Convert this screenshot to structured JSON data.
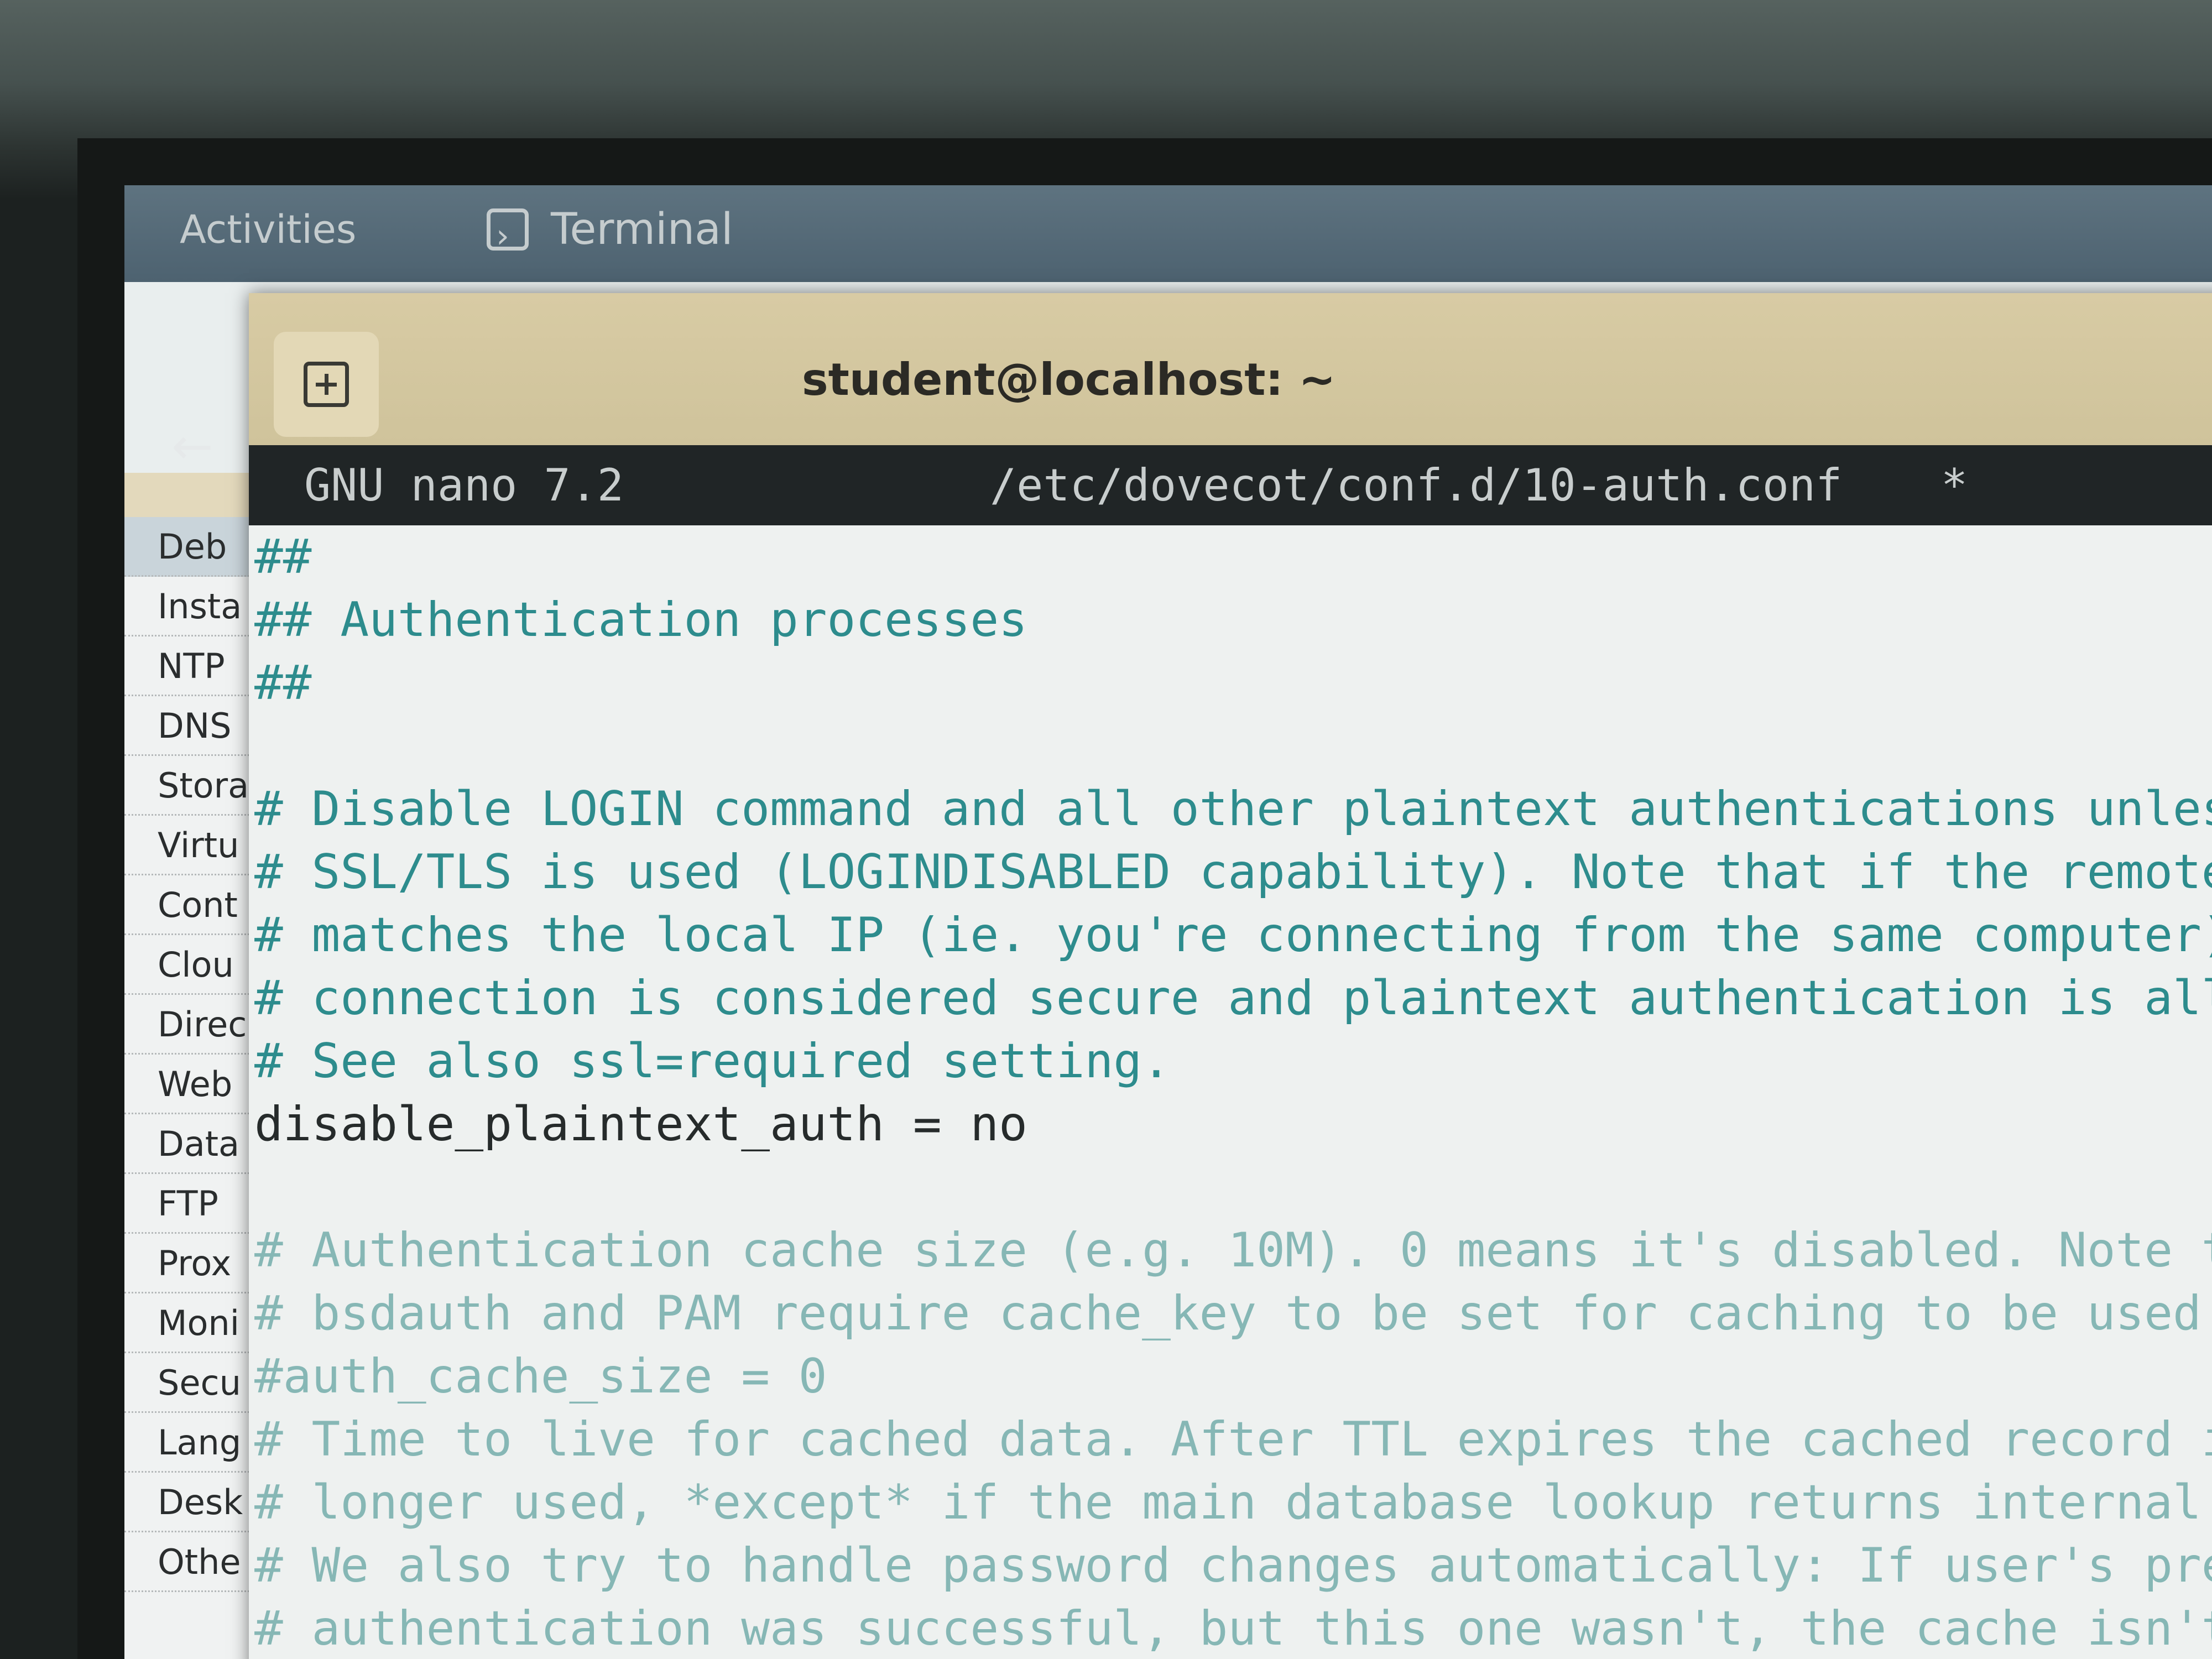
{
  "topbar": {
    "activities": "Activities",
    "app_name": "Terminal"
  },
  "sidebar": {
    "items": [
      {
        "label": "Deb",
        "active": true
      },
      {
        "label": "Insta"
      },
      {
        "label": "NTP"
      },
      {
        "label": "DNS"
      },
      {
        "label": "Stora"
      },
      {
        "label": "Virtu"
      },
      {
        "label": "Cont"
      },
      {
        "label": "Clou"
      },
      {
        "label": "Direc"
      },
      {
        "label": "Web"
      },
      {
        "label": "Data"
      },
      {
        "label": "FTP"
      },
      {
        "label": "Prox"
      },
      {
        "label": "Moni"
      },
      {
        "label": "Secu"
      },
      {
        "label": "Lang"
      },
      {
        "label": "Desk"
      },
      {
        "label": "Othe"
      }
    ]
  },
  "terminal": {
    "title": "student@localhost: ~",
    "icons": {
      "new_tab": "plus-box-icon",
      "back": "left-arrow-icon"
    }
  },
  "nano": {
    "version": "GNU nano 7.2",
    "filename": "/etc/dovecot/conf.d/10-auth.conf",
    "modified_marker": "*",
    "lines": [
      {
        "text": "##",
        "type": "comment"
      },
      {
        "text": "## Authentication processes",
        "type": "comment"
      },
      {
        "text": "##",
        "type": "comment"
      },
      {
        "text": "",
        "type": "blank"
      },
      {
        "text": "# Disable LOGIN command and all other plaintext authentications unles",
        "type": "comment"
      },
      {
        "text": "# SSL/TLS is used (LOGINDISABLED capability). Note that if the remote",
        "type": "comment"
      },
      {
        "text": "# matches the local IP (ie. you're connecting from the same computer)",
        "type": "comment"
      },
      {
        "text": "# connection is considered secure and plaintext authentication is all",
        "type": "comment"
      },
      {
        "text": "# See also ssl=required setting.",
        "type": "comment"
      },
      {
        "text": "disable_plaintext_auth = no",
        "type": "plain"
      },
      {
        "text": "",
        "type": "blank"
      },
      {
        "text": "# Authentication cache size (e.g. 10M). 0 means it's disabled. Note th",
        "type": "comment-faint"
      },
      {
        "text": "# bsdauth and PAM require cache_key to be set for caching to be used.",
        "type": "comment-faint"
      },
      {
        "text": "#auth_cache_size = 0",
        "type": "comment-faint"
      },
      {
        "text": "# Time to live for cached data. After TTL expires the cached record is",
        "type": "comment-faint"
      },
      {
        "text": "# longer used, *except* if the main database lookup returns internal f",
        "type": "comment-faint"
      },
      {
        "text": "# We also try to handle password changes automatically: If user's prev",
        "type": "comment-faint"
      },
      {
        "text": "# authentication was successful, but this one wasn't, the cache isn't",
        "type": "comment-faint"
      }
    ]
  }
}
